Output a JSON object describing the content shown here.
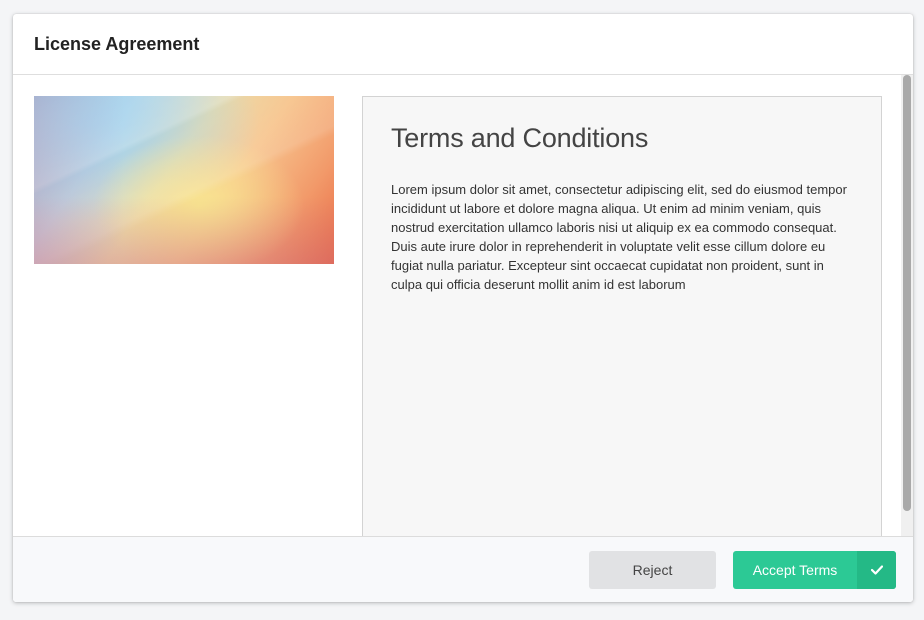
{
  "header": {
    "title": "License Agreement"
  },
  "content": {
    "image_name": "gradient-banner",
    "terms": {
      "heading": "Terms and Conditions",
      "body": "Lorem ipsum dolor sit amet, consectetur adipiscing elit, sed do eiusmod tempor incididunt ut labore et dolore magna aliqua. Ut enim ad minim veniam, quis nostrud exercitation ullamco laboris nisi ut aliquip ex ea commodo consequat. Duis aute irure dolor in reprehenderit in voluptate velit esse cillum dolore eu fugiat nulla pariatur. Excepteur sint occaecat cupidatat non proident, sunt in culpa qui officia deserunt mollit anim id est laborum"
    }
  },
  "footer": {
    "reject_label": "Reject",
    "accept_label": "Accept Terms",
    "accept_icon": "checkmark-icon"
  },
  "colors": {
    "accent": "#2cc995",
    "accent_dark": "#24b986",
    "reject_bg": "#e1e2e4"
  }
}
